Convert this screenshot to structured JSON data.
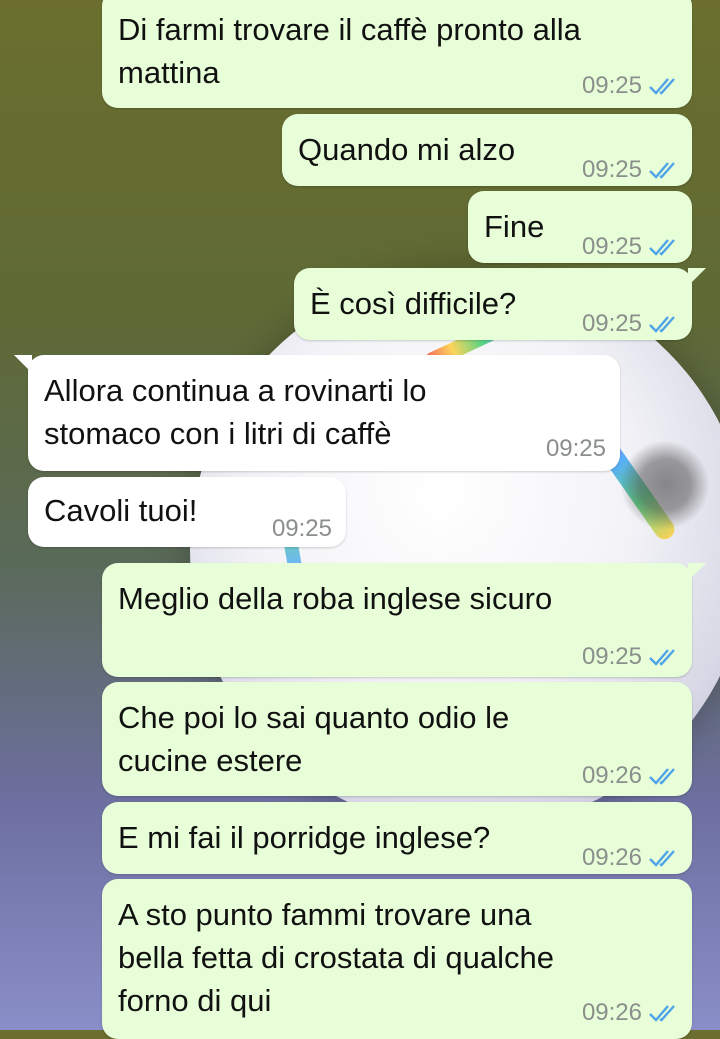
{
  "colors": {
    "outgoing_bubble": "#e7fed8",
    "incoming_bubble": "#ffffff",
    "read_ticks": "#4fa3e8",
    "timestamp": "#8a8f8c"
  },
  "messages": [
    {
      "direction": "out",
      "lines": [
        "Di farmi trovare il caffè pronto alla",
        "mattina"
      ],
      "time": "09:25",
      "status": "read"
    },
    {
      "direction": "out",
      "lines": [
        "Quando mi alzo"
      ],
      "time": "09:25",
      "status": "read"
    },
    {
      "direction": "out",
      "lines": [
        "Fine"
      ],
      "time": "09:25",
      "status": "read"
    },
    {
      "direction": "out",
      "lines": [
        "È così difficile?"
      ],
      "time": "09:25",
      "status": "read"
    },
    {
      "direction": "in",
      "lines": [
        "Allora continua a rovinarti lo",
        "stomaco con i litri di caffè"
      ],
      "time": "09:25"
    },
    {
      "direction": "in",
      "lines": [
        "Cavoli tuoi!"
      ],
      "time": "09:25"
    },
    {
      "direction": "out",
      "lines": [
        "Meglio della roba inglese sicuro"
      ],
      "time": "09:25",
      "status": "read"
    },
    {
      "direction": "out",
      "lines": [
        "Che poi lo sai quanto odio le",
        "cucine estere"
      ],
      "time": "09:26",
      "status": "read"
    },
    {
      "direction": "out",
      "lines": [
        "E mi fai il porridge inglese?"
      ],
      "time": "09:26",
      "status": "read"
    },
    {
      "direction": "out",
      "lines": [
        "A sto punto fammi trovare una",
        "bella fetta di crostata di qualche",
        "forno di qui"
      ],
      "time": "09:26",
      "status": "read"
    }
  ]
}
